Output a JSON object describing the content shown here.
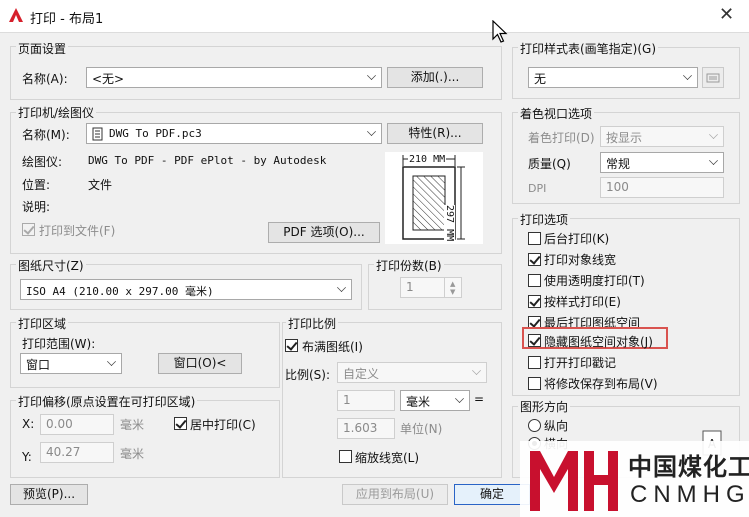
{
  "window": {
    "title": "打印 - 布局1",
    "close": "✕"
  },
  "page_setup": {
    "title": "页面设置",
    "name_label": "名称(A):",
    "name_value": "<无>",
    "add_button": "添加(.)..."
  },
  "printer": {
    "title": "打印机/绘图仪",
    "name_label": "名称(M):",
    "name_value": "DWG To PDF.pc3",
    "properties_button": "特性(R)...",
    "plotter_label": "绘图仪:",
    "plotter_value": "DWG To PDF - PDF ePlot - by Autodesk",
    "location_label": "位置:",
    "location_value": "文件",
    "description_label": "说明:",
    "print_to_file": "打印到文件(F)",
    "pdf_options_button": "PDF 选项(O)...",
    "preview_width": "210 MM",
    "preview_height": "297 MM"
  },
  "paper_size": {
    "title": "图纸尺寸(Z)",
    "value": "ISO A4 (210.00 x 297.00 毫米)"
  },
  "copies": {
    "title": "打印份数(B)",
    "value": "1"
  },
  "plot_area": {
    "title": "打印区域",
    "range_label": "打印范围(W):",
    "range_value": "窗口",
    "window_button": "窗口(O)<"
  },
  "plot_offset": {
    "title": "打印偏移(原点设置在可打印区域)",
    "x_label": "X:",
    "x_value": "0.00",
    "x_unit": "毫米",
    "y_label": "Y:",
    "y_value": "40.27",
    "y_unit": "毫米",
    "center_label": "居中打印(C)"
  },
  "plot_scale": {
    "title": "打印比例",
    "fit_label": "布满图纸(I)",
    "scale_label": "比例(S):",
    "scale_value": "自定义",
    "num_value": "1",
    "unit_value": "毫米",
    "equals": "=",
    "den_value": "1.603",
    "den_unit": "单位(N)",
    "lineweights_label": "缩放线宽(L)"
  },
  "plot_style": {
    "title": "打印样式表(画笔指定)(G)",
    "value": "无"
  },
  "shaded_viewport": {
    "title": "着色视口选项",
    "shade_label": "着色打印(D)",
    "shade_value": "按显示",
    "quality_label": "质量(Q)",
    "quality_value": "常规",
    "dpi_label": "DPI",
    "dpi_value": "100"
  },
  "plot_options": {
    "title": "打印选项",
    "items": [
      {
        "label": "后台打印(K)"
      },
      {
        "label": "打印对象线宽"
      },
      {
        "label": "使用透明度打印(T)"
      },
      {
        "label": "按样式打印(E)"
      },
      {
        "label": "最后打印图纸空间"
      },
      {
        "label": "隐藏图纸空间对象(J)"
      },
      {
        "label": "打开打印戳记"
      },
      {
        "label": "将修改保存到布局(V)"
      }
    ],
    "highlight_color": "#d9534f"
  },
  "orientation": {
    "title": "图形方向",
    "portrait": "纵向",
    "landscape": "横向"
  },
  "footer": {
    "preview_button": "预览(P)...",
    "apply_button": "应用到布局(U)",
    "ok_button": "确定"
  },
  "watermark": {
    "brand_cn": "中国煤化工",
    "brand_en": "CNMHG",
    "logo_color": "#c8102e"
  }
}
